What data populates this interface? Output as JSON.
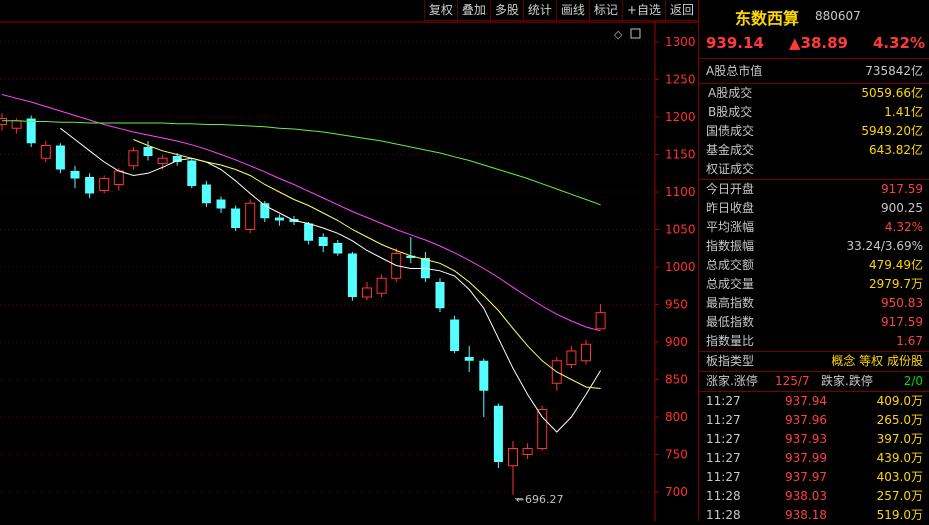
{
  "toolbar": [
    "复权",
    "叠加",
    "多股",
    "统计",
    "画线",
    "标记",
    "+自选",
    "返回"
  ],
  "chart_data": {
    "type": "candlestick",
    "y_ticks": [
      1300,
      1250,
      1200,
      1150,
      1100,
      1050,
      1000,
      950,
      900,
      850,
      800,
      750,
      700
    ],
    "low_marker_label": "696.27",
    "candles": [
      {
        "o": 1190,
        "c": 1198,
        "h": 1205,
        "l": 1182
      },
      {
        "o": 1185,
        "c": 1195,
        "h": 1198,
        "l": 1178
      },
      {
        "o": 1198,
        "c": 1165,
        "h": 1202,
        "l": 1160
      },
      {
        "o": 1145,
        "c": 1162,
        "h": 1168,
        "l": 1140
      },
      {
        "o": 1162,
        "c": 1130,
        "h": 1165,
        "l": 1125
      },
      {
        "o": 1128,
        "c": 1118,
        "h": 1135,
        "l": 1105
      },
      {
        "o": 1120,
        "c": 1098,
        "h": 1125,
        "l": 1092
      },
      {
        "o": 1102,
        "c": 1118,
        "h": 1122,
        "l": 1098
      },
      {
        "o": 1110,
        "c": 1128,
        "h": 1132,
        "l": 1102
      },
      {
        "o": 1135,
        "c": 1155,
        "h": 1160,
        "l": 1130
      },
      {
        "o": 1160,
        "c": 1148,
        "h": 1168,
        "l": 1142
      },
      {
        "o": 1138,
        "c": 1145,
        "h": 1150,
        "l": 1130
      },
      {
        "o": 1148,
        "c": 1140,
        "h": 1152,
        "l": 1135
      },
      {
        "o": 1142,
        "c": 1108,
        "h": 1145,
        "l": 1105
      },
      {
        "o": 1110,
        "c": 1085,
        "h": 1115,
        "l": 1080
      },
      {
        "o": 1090,
        "c": 1078,
        "h": 1094,
        "l": 1072
      },
      {
        "o": 1078,
        "c": 1052,
        "h": 1082,
        "l": 1048
      },
      {
        "o": 1050,
        "c": 1085,
        "h": 1090,
        "l": 1045
      },
      {
        "o": 1085,
        "c": 1065,
        "h": 1088,
        "l": 1060
      },
      {
        "o": 1066,
        "c": 1062,
        "h": 1070,
        "l": 1055
      },
      {
        "o": 1064,
        "c": 1060,
        "h": 1068,
        "l": 1056
      },
      {
        "o": 1058,
        "c": 1035,
        "h": 1060,
        "l": 1030
      },
      {
        "o": 1040,
        "c": 1028,
        "h": 1045,
        "l": 1020
      },
      {
        "o": 1032,
        "c": 1018,
        "h": 1036,
        "l": 1015
      },
      {
        "o": 1018,
        "c": 960,
        "h": 1020,
        "l": 955
      },
      {
        "o": 960,
        "c": 972,
        "h": 980,
        "l": 956
      },
      {
        "o": 965,
        "c": 985,
        "h": 990,
        "l": 960
      },
      {
        "o": 985,
        "c": 1018,
        "h": 1025,
        "l": 980
      },
      {
        "o": 1015,
        "c": 1012,
        "h": 1040,
        "l": 1005
      },
      {
        "o": 1012,
        "c": 985,
        "h": 1020,
        "l": 980
      },
      {
        "o": 980,
        "c": 945,
        "h": 985,
        "l": 940
      },
      {
        "o": 930,
        "c": 888,
        "h": 935,
        "l": 885
      },
      {
        "o": 880,
        "c": 875,
        "h": 895,
        "l": 860
      },
      {
        "o": 875,
        "c": 835,
        "h": 878,
        "l": 800
      },
      {
        "o": 815,
        "c": 740,
        "h": 818,
        "l": 732
      },
      {
        "o": 735,
        "c": 758,
        "h": 768,
        "l": 696.27
      },
      {
        "o": 750,
        "c": 758,
        "h": 765,
        "l": 744
      },
      {
        "o": 758,
        "c": 810,
        "h": 815,
        "l": 755
      },
      {
        "o": 845,
        "c": 875,
        "h": 880,
        "l": 835
      },
      {
        "o": 870,
        "c": 888,
        "h": 895,
        "l": 865
      },
      {
        "o": 875,
        "c": 897,
        "h": 903,
        "l": 870
      },
      {
        "o": 917.59,
        "c": 939.14,
        "h": 950.83,
        "l": 917.59
      }
    ],
    "ma_lines": [
      {
        "color": "#ffffff",
        "values": [
          null,
          null,
          null,
          null,
          1185,
          1170,
          1155,
          1140,
          1128,
          1122,
          1125,
          1133,
          1142,
          1145,
          1140,
          1130,
          1115,
          1098,
          1082,
          1072,
          1062,
          1058,
          1052,
          1045,
          1035,
          1022,
          1012,
          1002,
          998,
          998,
          995,
          988,
          970,
          945,
          905,
          865,
          830,
          800,
          780,
          800,
          830,
          862
        ]
      },
      {
        "color": "#ffff66",
        "values": [
          null,
          null,
          null,
          null,
          null,
          null,
          null,
          null,
          null,
          1170,
          1162,
          1155,
          1150,
          1145,
          1140,
          1136,
          1130,
          1122,
          1110,
          1100,
          1090,
          1082,
          1072,
          1062,
          1050,
          1040,
          1030,
          1022,
          1015,
          1010,
          1005,
          995,
          980,
          962,
          942,
          918,
          895,
          875,
          860,
          850,
          840,
          838
        ]
      },
      {
        "color": "#ff44ff",
        "values": [
          1230,
          1225,
          1220,
          1214,
          1208,
          1202,
          1196,
          1190,
          1185,
          1180,
          1176,
          1172,
          1168,
          1163,
          1157,
          1150,
          1143,
          1135,
          1127,
          1118,
          1110,
          1101,
          1092,
          1083,
          1074,
          1066,
          1058,
          1050,
          1043,
          1036,
          1028,
          1019,
          1009,
          998,
          986,
          973,
          960,
          948,
          937,
          928,
          920,
          915
        ]
      },
      {
        "color": "#66ee44",
        "values": [
          1195,
          1195,
          1194,
          1194,
          1193,
          1193,
          1192,
          1192,
          1192,
          1192,
          1192,
          1192,
          1191,
          1191,
          1190,
          1190,
          1189,
          1188,
          1187,
          1185,
          1184,
          1182,
          1180,
          1177,
          1174,
          1171,
          1168,
          1164,
          1160,
          1156,
          1152,
          1147,
          1142,
          1136,
          1130,
          1124,
          1118,
          1111,
          1104,
          1097,
          1090,
          1083
        ]
      }
    ]
  },
  "panel": {
    "name": "东数西算",
    "code": "880607",
    "price": "939.14",
    "change": "▲38.89",
    "pct": "4.32%",
    "market_cap": {
      "label": "A股总市值",
      "value": "735842亿"
    },
    "stats": [
      {
        "label": "A股成交",
        "value": "5059.66亿",
        "cls": "yel",
        "pad": true
      },
      {
        "label": "B股成交",
        "value": "1.41亿",
        "cls": "yel",
        "pad": true
      },
      {
        "label": "国债成交",
        "value": "5949.20亿",
        "cls": "yel"
      },
      {
        "label": "基金成交",
        "value": "643.82亿",
        "cls": "yel"
      },
      {
        "label": "权证成交",
        "value": "",
        "cls": "yel",
        "sep": true
      },
      {
        "label": "今日开盘",
        "value": "917.59",
        "cls": "red"
      },
      {
        "label": "昨日收盘",
        "value": "900.25",
        "cls": ""
      },
      {
        "label": "平均涨幅",
        "value": "4.32%",
        "cls": "red"
      },
      {
        "label": "指数振幅",
        "value": "33.24/3.69%",
        "cls": ""
      },
      {
        "label": "总成交额",
        "value": "479.49亿",
        "cls": "yel"
      },
      {
        "label": "总成交量",
        "value": "2979.7万",
        "cls": "yel"
      },
      {
        "label": "最高指数",
        "value": "950.83",
        "cls": "red"
      },
      {
        "label": "最低指数",
        "value": "917.59",
        "cls": "red"
      },
      {
        "label": "指数量比",
        "value": "1.67",
        "cls": "red",
        "sep": true
      }
    ],
    "board_type": {
      "label": "板指类型",
      "value": "概念 等权 成份股"
    },
    "updown": {
      "label1": "涨家.涨停",
      "val1": "125/7",
      "label2": "跌家.跌停",
      "val2": "2/0"
    },
    "ticks": [
      {
        "time": "11:27",
        "price": "937.94",
        "vol": "409.0万"
      },
      {
        "time": "11:27",
        "price": "937.96",
        "vol": "265.0万"
      },
      {
        "time": "11:27",
        "price": "937.93",
        "vol": "397.0万"
      },
      {
        "time": "11:27",
        "price": "937.99",
        "vol": "439.0万"
      },
      {
        "time": "11:27",
        "price": "937.97",
        "vol": "403.0万"
      },
      {
        "time": "11:28",
        "price": "938.03",
        "vol": "257.0万"
      },
      {
        "time": "11:28",
        "price": "938.18",
        "vol": "519.0万"
      }
    ]
  }
}
